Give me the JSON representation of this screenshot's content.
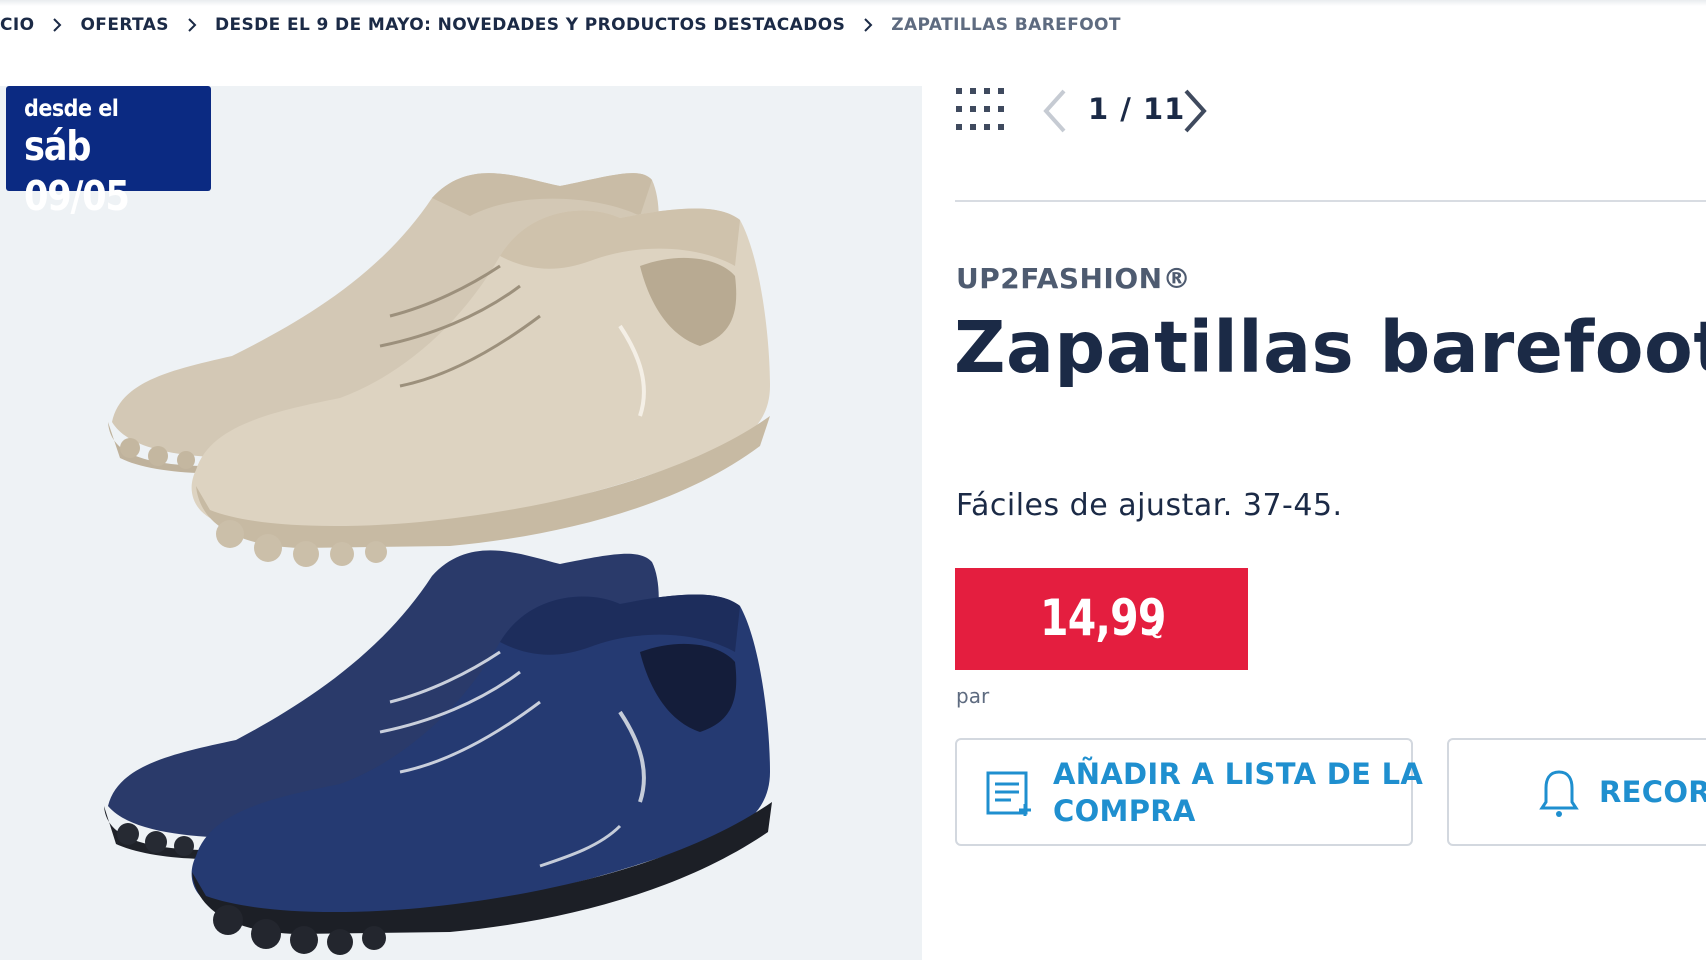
{
  "breadcrumb": {
    "items": [
      "CIO",
      "OFERTAS",
      "DESDE EL 9 DE MAYO: NOVEDADES Y PRODUCTOS DESTACADOS",
      "ZAPATILLAS BAREFOOT"
    ]
  },
  "badge": {
    "line1": "desde el",
    "line2": "sáb 09/05"
  },
  "gallery": {
    "pager": "1 / 11",
    "icons": [
      "grid-icon",
      "chevron-left-icon",
      "chevron-right-icon"
    ]
  },
  "product": {
    "brand": "UP2FASHION®",
    "title": "Zapatillas barefoot",
    "description": "Fáciles de ajustar. 37-45.",
    "price": "14,99",
    "currency": "€",
    "unit": "par"
  },
  "actions": {
    "add_list_line1": "AÑADIR A LISTA DE LA",
    "add_list_line2": "COMPRA",
    "remind": "RECORD"
  },
  "colors": {
    "navy": "#1b2a46",
    "badge_blue": "#0b2a82",
    "price_red": "#e41e3f",
    "link_blue": "#1f8fcf",
    "image_bg": "#eef2f5"
  }
}
